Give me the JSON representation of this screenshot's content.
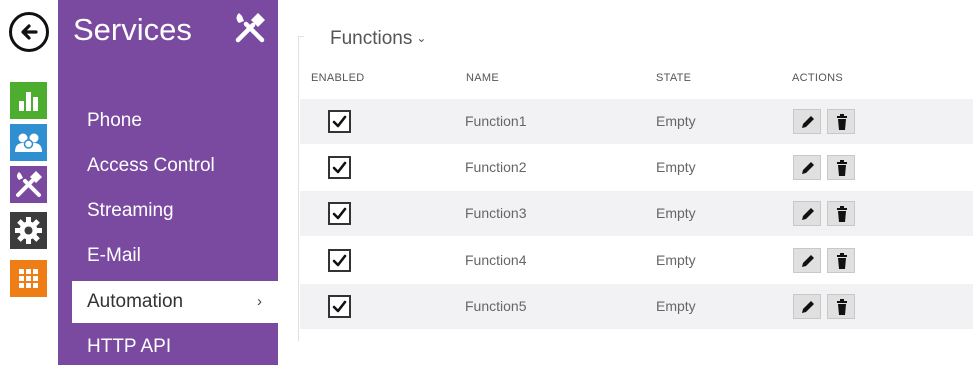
{
  "rail": {
    "back": "back-arrow-icon",
    "items": [
      "status-icon",
      "users-icon",
      "services-icon",
      "hardware-icon",
      "system-icon"
    ]
  },
  "services_panel": {
    "title": "Services",
    "icon": "tools-icon",
    "menu": [
      "Phone",
      "Access Control",
      "Streaming",
      "E-Mail",
      "Automation",
      "HTTP API"
    ],
    "active_index": 4,
    "active_chevron": "›"
  },
  "content": {
    "title": "Functions",
    "title_chevron": "⌄",
    "columns": {
      "enabled": "ENABLED",
      "name": "NAME",
      "state": "STATE",
      "actions": "ACTIONS"
    },
    "rows": [
      {
        "enabled": true,
        "name": "Function1",
        "state": "Empty"
      },
      {
        "enabled": true,
        "name": "Function2",
        "state": "Empty"
      },
      {
        "enabled": true,
        "name": "Function3",
        "state": "Empty"
      },
      {
        "enabled": true,
        "name": "Function4",
        "state": "Empty"
      },
      {
        "enabled": true,
        "name": "Function5",
        "state": "Empty"
      }
    ],
    "row_actions": [
      "edit-pencil-icon",
      "delete-trash-icon"
    ]
  },
  "colors": {
    "accent_purple": "#7a4aa0",
    "status_green": "#4cad2e",
    "users_blue": "#2f8fd1",
    "system_orange": "#ef7d16",
    "hardware_dark": "#3c3c3c"
  }
}
